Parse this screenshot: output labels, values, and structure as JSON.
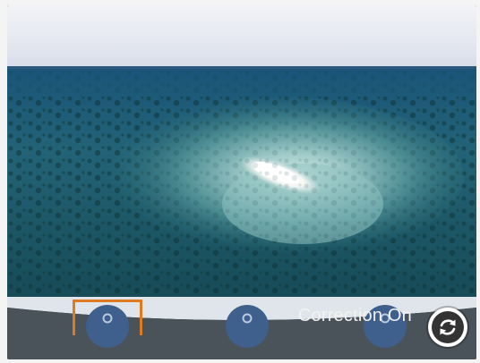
{
  "status": {
    "correction_label": "Correction On"
  },
  "icons": {
    "refresh": "refresh-icon",
    "preset_1": "circle-icon",
    "preset_2": "circle-icon",
    "preset_3": "circle-icon"
  },
  "colors": {
    "selection": "#e07a1f",
    "toolbar": "#4b535a",
    "preset": "#3f5f8c",
    "water_deep": "#1c5267",
    "water_shallow": "#7fb6b6"
  }
}
